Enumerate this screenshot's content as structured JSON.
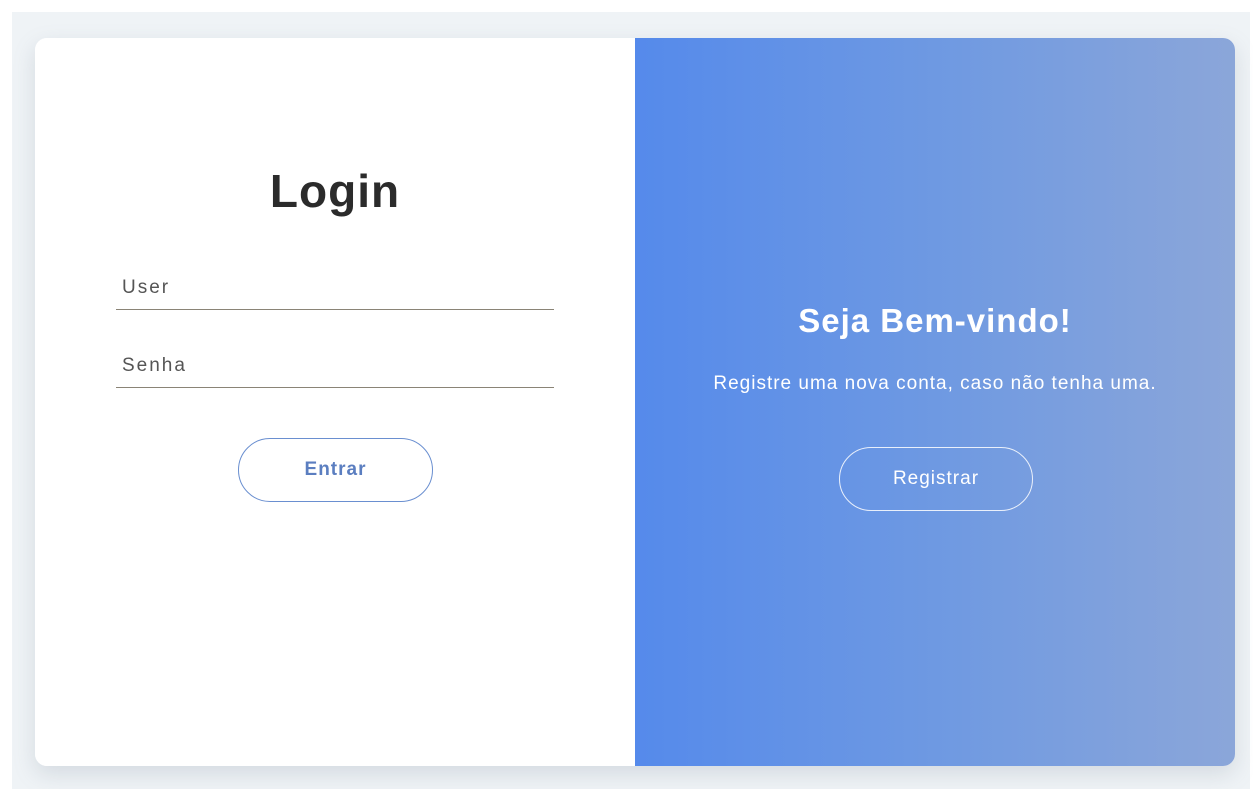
{
  "login": {
    "title": "Login",
    "user_placeholder": "User",
    "password_placeholder": "Senha",
    "submit_label": "Entrar"
  },
  "welcome": {
    "title": "Seja Bem-vindo!",
    "text": "Registre uma nova conta, caso não tenha uma.",
    "register_label": "Registrar"
  },
  "colors": {
    "accent": "#558aeb",
    "gradient_end": "#8ba6d9",
    "title_text": "#2b2b2b",
    "button_text": "#5b7ec0"
  }
}
